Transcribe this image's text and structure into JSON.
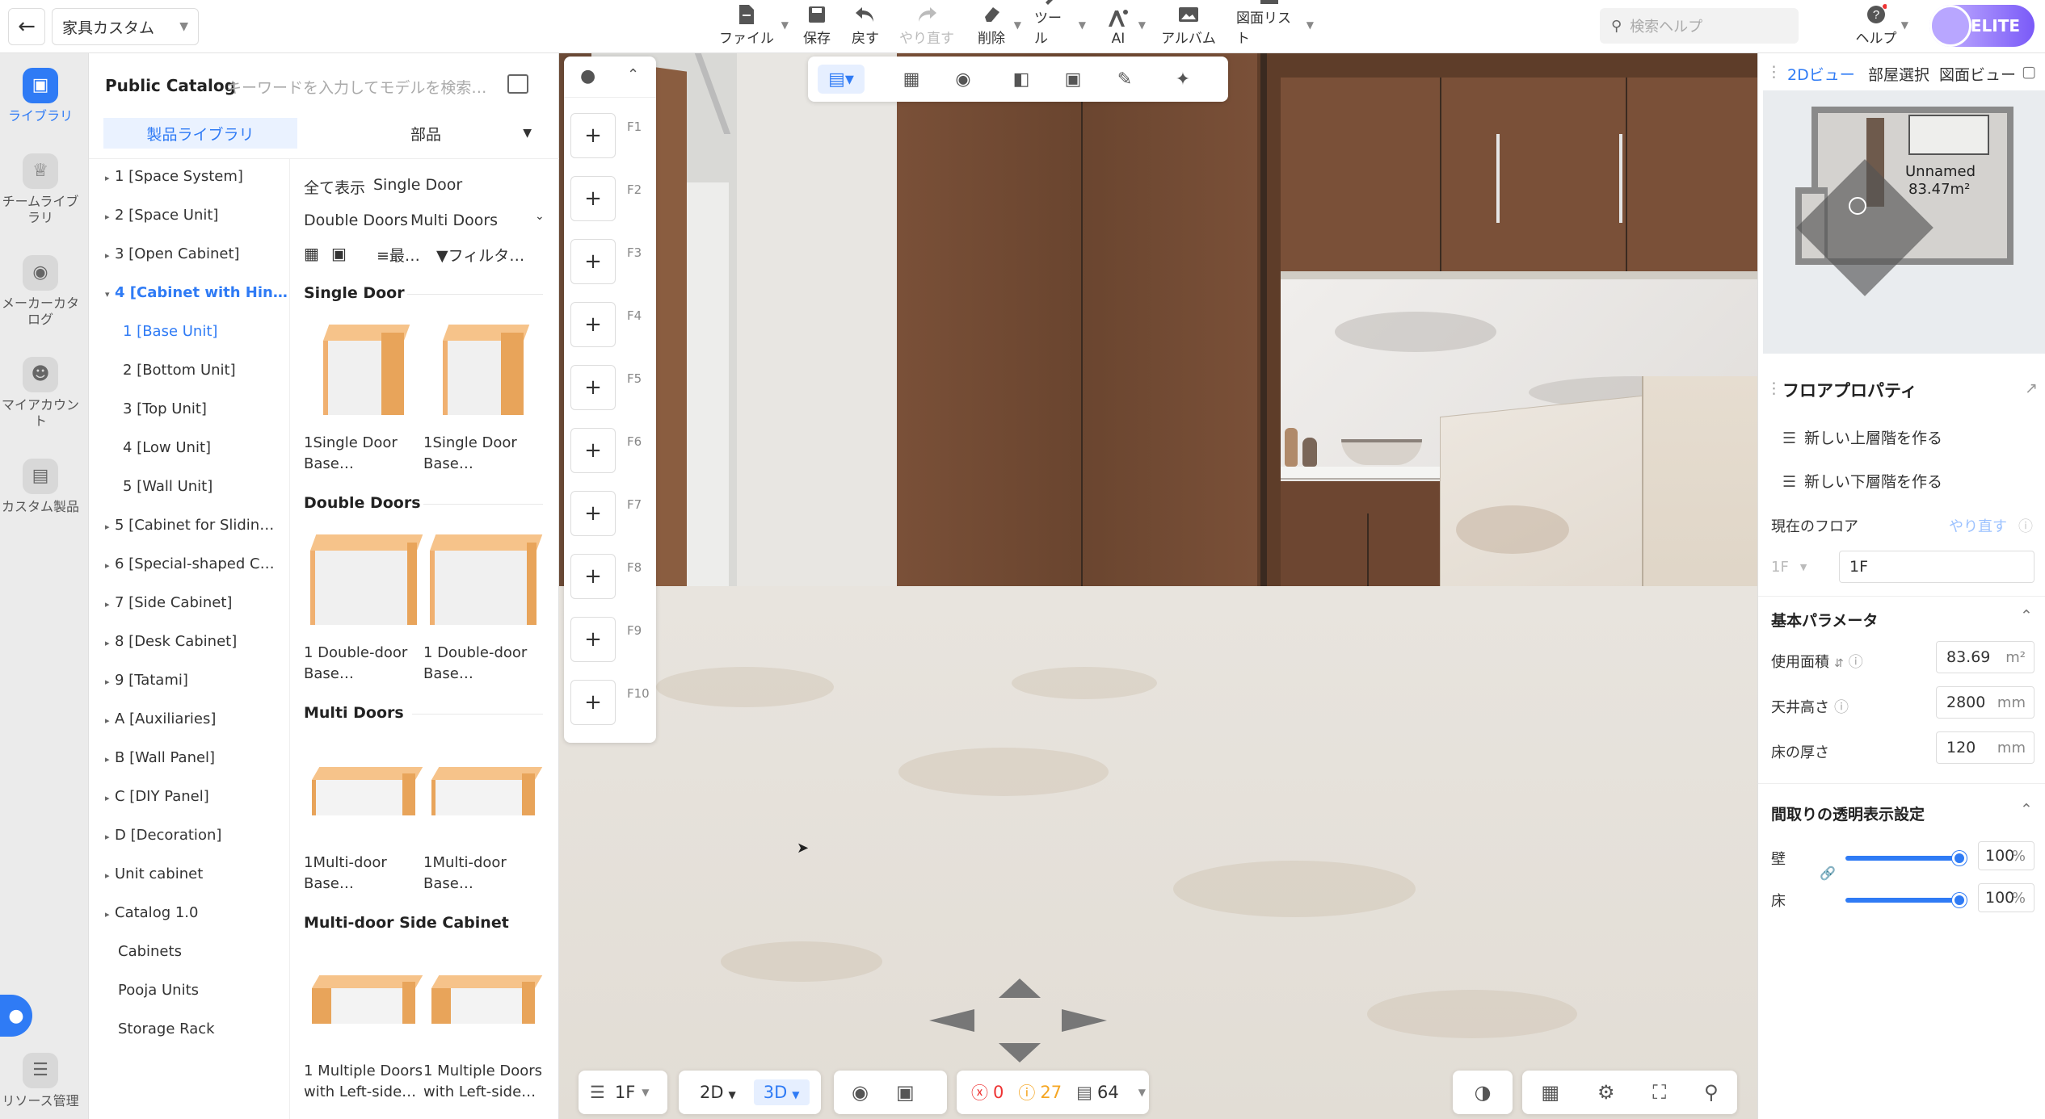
{
  "topbar": {
    "project_name": "家具カスタム",
    "tools": [
      {
        "label": "ファイル",
        "icon": "file-icon"
      },
      {
        "label": "保存",
        "icon": "save-icon"
      },
      {
        "label": "戻す",
        "icon": "undo-icon"
      },
      {
        "label": "やり直す",
        "icon": "redo-icon"
      },
      {
        "label": "削除",
        "icon": "eraser-icon"
      },
      {
        "label": "ツール",
        "icon": "wrench-icon"
      },
      {
        "label": "AI",
        "icon": "ai-icon"
      },
      {
        "label": "アルバム",
        "icon": "album-icon"
      },
      {
        "label": "図面リスト",
        "icon": "drawing-list-icon"
      }
    ],
    "search_placeholder": "検索ヘルプ",
    "help_label": "ヘルプ",
    "badge": "ELITE"
  },
  "rail": {
    "items": [
      {
        "label": "ライブラリ",
        "icon": "library-icon"
      },
      {
        "label": "チームライブラリ",
        "icon": "team-library-icon"
      },
      {
        "label": "メーカーカタログ",
        "icon": "maker-catalog-icon"
      },
      {
        "label": "マイアカウント",
        "icon": "account-icon"
      },
      {
        "label": "カスタム製品",
        "icon": "custom-product-icon"
      },
      {
        "label": "リソース管理",
        "icon": "resource-icon"
      }
    ]
  },
  "library": {
    "title": "Public Catalog",
    "search_placeholder": "キーワードを入力してモデルを検索…",
    "tab_products": "製品ライブラリ",
    "tab_parts": "部品",
    "tree": [
      {
        "label": "1 [Space System]"
      },
      {
        "label": "2 [Space Unit]"
      },
      {
        "label": "3 [Open Cabinet]"
      },
      {
        "label": "4 [Cabinet with Hin…"
      },
      {
        "label": "1 [Base Unit]"
      },
      {
        "label": "2 [Bottom Unit]"
      },
      {
        "label": "3 [Top Unit]"
      },
      {
        "label": "4 [Low Unit]"
      },
      {
        "label": "5 [Wall Unit]"
      },
      {
        "label": "5 [Cabinet for Slidin…"
      },
      {
        "label": "6 [Special-shaped C…"
      },
      {
        "label": "7 [Side Cabinet]"
      },
      {
        "label": "8 [Desk Cabinet]"
      },
      {
        "label": "9 [Tatami]"
      },
      {
        "label": "A [Auxiliaries]"
      },
      {
        "label": "B [Wall Panel]"
      },
      {
        "label": "C [DIY Panel]"
      },
      {
        "label": "D [Decoration]"
      },
      {
        "label": "Unit cabinet"
      },
      {
        "label": "Catalog 1.0"
      },
      {
        "label": "Cabinets"
      },
      {
        "label": "Pooja Units"
      },
      {
        "label": "Storage Rack"
      }
    ],
    "filters": {
      "all": "全て表示",
      "single": "Single Door",
      "double": "Double Doors",
      "multi": "Multi Doors",
      "sort": "最…",
      "filter": "フィルタ…"
    },
    "sections": [
      {
        "title": "Single Door",
        "items": [
          {
            "l1": "1Single Door",
            "l2": "Base…"
          },
          {
            "l1": "1Single Door",
            "l2": "Base…"
          }
        ]
      },
      {
        "title": "Double Doors",
        "items": [
          {
            "l1": "1 Double-door",
            "l2": "Base…"
          },
          {
            "l1": "1 Double-door",
            "l2": "Base…"
          }
        ]
      },
      {
        "title": "Multi Doors",
        "items": [
          {
            "l1": "1Multi-door",
            "l2": "Base…"
          },
          {
            "l1": "1Multi-door",
            "l2": "Base…"
          }
        ]
      },
      {
        "title": "Multi-door Side Cabinet",
        "items": [
          {
            "l1": "1 Multiple Doors",
            "l2": "with Left-side…"
          },
          {
            "l1": "1 Multiple Doors",
            "l2": "with Left-side…"
          }
        ]
      }
    ]
  },
  "floors": [
    "F1",
    "F2",
    "F3",
    "F4",
    "F5",
    "F6",
    "F7",
    "F8",
    "F9",
    "F10"
  ],
  "bottom": {
    "floor": "1F",
    "mode_2d": "2D",
    "mode_3d": "3D",
    "errors": "0",
    "warnings": "27",
    "items": "64"
  },
  "rpanel": {
    "tabs": [
      "2Dビュー",
      "部屋選択",
      "図面ビュー"
    ],
    "room_name": "Unnamed",
    "room_area": "83.47m²",
    "title": "フロアプロパティ",
    "new_upper": "新しい上層階を作る",
    "new_lower": "新しい下層階を作る",
    "current_floor_label": "現在のフロア",
    "redo_link": "やり直す",
    "floor_select": "1F",
    "floor_name": "1F",
    "basic_params": "基本パラメータ",
    "area_label": "使用面積",
    "area_value": "83.69",
    "area_unit": "m²",
    "ceiling_label": "天井高さ",
    "ceiling_value": "2800",
    "ceiling_unit": "mm",
    "floor_thick_label": "床の厚さ",
    "floor_thick_value": "120",
    "floor_thick_unit": "mm",
    "transparency_title": "間取りの透明表示設定",
    "wall_label": "壁",
    "wall_value": "100",
    "floor_label": "床",
    "floor_value": "100",
    "percent": "%"
  }
}
